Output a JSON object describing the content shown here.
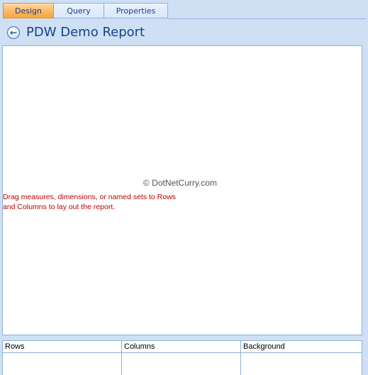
{
  "tabs": [
    {
      "label": "Design",
      "active": true
    },
    {
      "label": "Query",
      "active": false
    },
    {
      "label": "Properties",
      "active": false
    }
  ],
  "header": {
    "back_icon": "back-arrow-icon",
    "title": "PDW Demo Report"
  },
  "surface": {
    "watermark": "© DotNetCurry.com",
    "hint": "Drag measures, dimensions, or named sets to Rows and Columns to lay out the report."
  },
  "zones": {
    "rows_label": "Rows",
    "columns_label": "Columns",
    "background_label": "Background"
  },
  "colors": {
    "accent_tab": "#fbb765",
    "title": "#15428b",
    "hint": "#c00000",
    "frame": "#cfe0f5"
  }
}
